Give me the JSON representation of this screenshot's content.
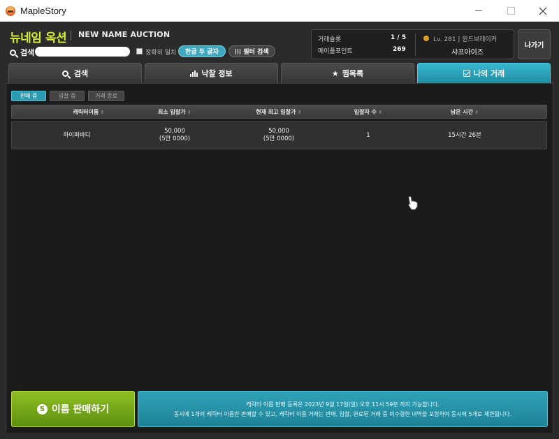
{
  "window": {
    "title": "MapleStory"
  },
  "brand": {
    "title_ko": "뉴네임 옥션",
    "title_en": "NEW NAME AUCTION"
  },
  "search": {
    "label": "검색",
    "input_value": "",
    "exact_match_label": "정확히 일치",
    "hangul_button": "한글 두 글자",
    "filter_button": "필터 검색"
  },
  "info": {
    "trade_slots_label": "거래슬롯",
    "trade_slots_value": "1 / 5",
    "maple_points_label": "메이플포인트",
    "maple_points_value": "269",
    "character_level": "Lv. 281 | 윈드브레이커",
    "character_name": "샤프아이즈",
    "exit_button": "나가기"
  },
  "tabs": [
    {
      "label": "검색",
      "icon": "search-icon",
      "active": false
    },
    {
      "label": "낙찰 정보",
      "icon": "bar-chart-icon",
      "active": false
    },
    {
      "label": "찜목록",
      "icon": "star-icon",
      "active": false
    },
    {
      "label": "나의 거래",
      "icon": "check-box-icon",
      "active": true
    }
  ],
  "subtabs": [
    {
      "label": "판매 중",
      "active": true
    },
    {
      "label": "입찰 중",
      "active": false
    },
    {
      "label": "거래 종료",
      "active": false
    }
  ],
  "table": {
    "columns": [
      "캐릭터이름",
      "최소 입찰가",
      "현재 최고 입찰가",
      "입찰자 수",
      "남은 시간"
    ],
    "rows": [
      {
        "name": "하이퍼바디",
        "min_bid": "50,000",
        "min_bid_sub": "(5만 0000)",
        "top_bid": "50,000",
        "top_bid_sub": "(5만 0000)",
        "bidders": "1",
        "remaining": "15시간 26분"
      }
    ]
  },
  "sell_button": {
    "coin_symbol": "S",
    "label": "이름 판매하기"
  },
  "notice": {
    "line1": "캐릭터 이름 판매 등록은 2023년 9월 17일(일) 오후 11시 59분 까지 가능합니다.",
    "line2": "동시에 1개의 캐릭터 이름만 판매할 수 있고, 캐릭터 이름 거래는 판매, 입찰, 완료된 거래 중 미수령한 내역을 포함하여 동시에 5개로 제한됩니다."
  },
  "colors": {
    "accent": "#2a9bb2",
    "brand_green": "#d6ee3a",
    "sell_green": "#7aab1a",
    "frame_bg": "#2b2b2b",
    "panel_bg": "#1b1b1b"
  }
}
